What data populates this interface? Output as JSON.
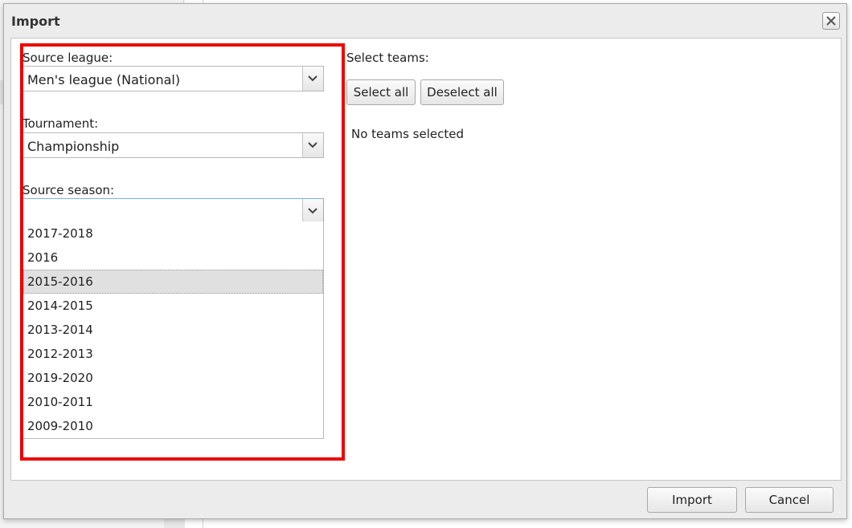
{
  "dialog": {
    "title": "Import",
    "close_icon": "close-icon"
  },
  "form": {
    "source_league": {
      "label": "Source league:",
      "value": "Men's league (National)"
    },
    "tournament": {
      "label": "Tournament:",
      "value": "Championship"
    },
    "source_season": {
      "label": "Source season:",
      "value": "",
      "options": [
        "2017-2018",
        "2016",
        "2015-2016",
        "2014-2015",
        "2013-2014",
        "2012-2013",
        "2019-2020",
        "2010-2011",
        "2009-2010"
      ],
      "hovered_option": "2015-2016"
    }
  },
  "teams": {
    "label": "Select teams:",
    "select_all": "Select all",
    "deselect_all": "Deselect all",
    "empty_text": "No teams selected"
  },
  "footer": {
    "import": "Import",
    "cancel": "Cancel"
  },
  "colors": {
    "highlight_border": "#ee0000",
    "hover_row": "#e0e0e0"
  }
}
